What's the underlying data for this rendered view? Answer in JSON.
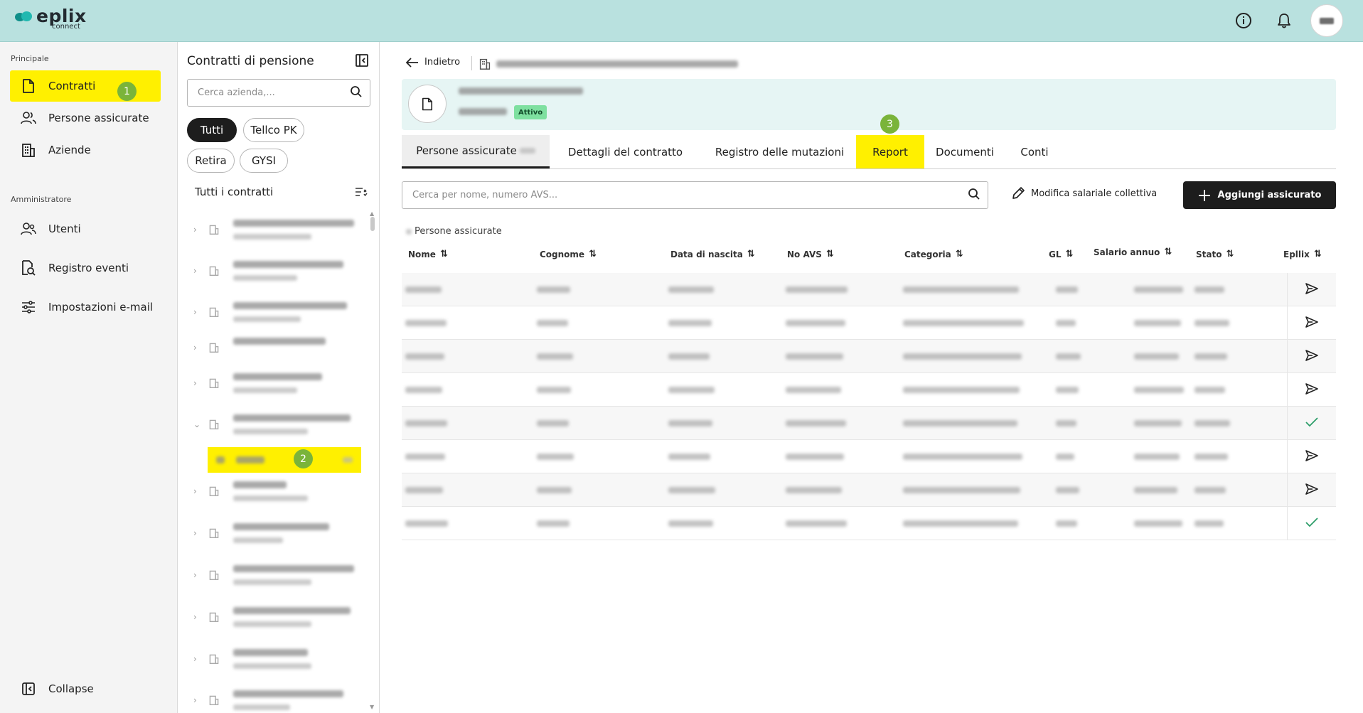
{
  "topbar": {
    "brand": "eplix",
    "brand_sub": "connect",
    "icons": [
      "info-icon",
      "bell-icon"
    ]
  },
  "leftnav": {
    "section_main": "Principale",
    "section_admin": "Amministratore",
    "items": [
      {
        "label": "Contratti",
        "icon": "document-icon",
        "active": true
      },
      {
        "label": "Persone assicurate",
        "icon": "people-icon"
      },
      {
        "label": "Aziende",
        "icon": "building-icon"
      },
      {
        "label": "Utenti",
        "icon": "users-icon"
      },
      {
        "label": "Registro eventi",
        "icon": "log-icon"
      },
      {
        "label": "Impostazioni e-mail",
        "icon": "settings-sliders-icon"
      }
    ],
    "collapse_label": "Collapse",
    "highlight_color": "#fff000",
    "badges": [
      "1",
      "2",
      "3"
    ]
  },
  "panel": {
    "title": "Contratti di pensione",
    "search_placeholder": "Cerca azienda,...",
    "chips": [
      {
        "label": "Tutti",
        "selected": true
      },
      {
        "label": "Tellco PK",
        "selected": false
      },
      {
        "label": "Retira",
        "selected": false
      },
      {
        "label": "GYSI",
        "selected": false
      }
    ],
    "list_title": "Tutti i contratti"
  },
  "main": {
    "back_label": "Indietro",
    "status": "Attivo",
    "tabs": [
      {
        "label": "Persone assicurate",
        "selected": true
      },
      {
        "label": "Dettagli del contratto"
      },
      {
        "label": "Registro delle mutazioni"
      },
      {
        "label": "Report",
        "highlighted": true
      },
      {
        "label": "Documenti"
      },
      {
        "label": "Conti"
      }
    ],
    "search_placeholder": "Cerca per nome, numero AVS...",
    "edit_salary_label": "Modifica salariale collettiva",
    "add_insured_label": "Aggiungi assicurato",
    "table_caption": "Persone assicurate",
    "columns": [
      "Nome",
      "Cognome",
      "Data di nascita",
      "No AVS",
      "Categoria",
      "GL",
      "Salario annuo",
      "Stato",
      "Epllix"
    ],
    "rows_eplix_status": [
      "send-icon",
      "send-icon",
      "send-icon",
      "send-icon",
      "check-icon",
      "send-icon",
      "send-icon",
      "check-icon"
    ],
    "accent_color": "#1d1d1d",
    "check_color": "#2e9e6a"
  }
}
